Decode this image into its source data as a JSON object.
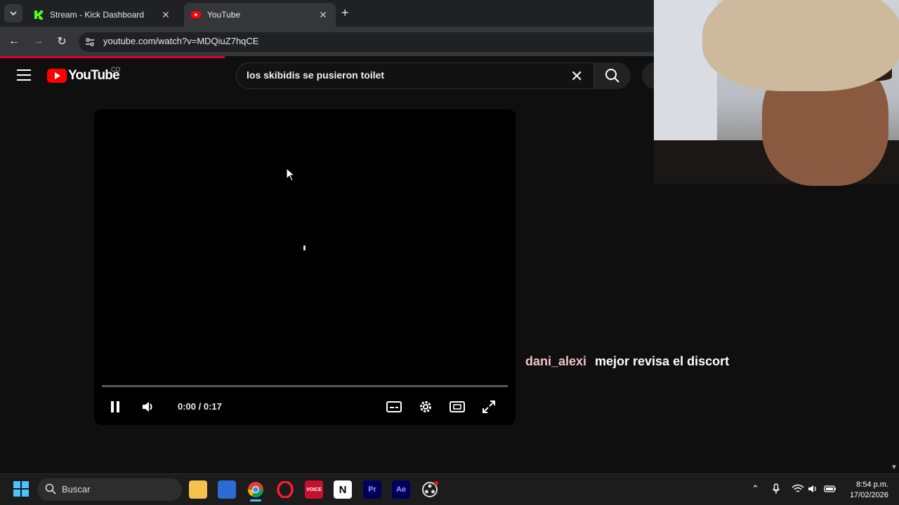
{
  "browser": {
    "tabs": [
      {
        "title": "Stream - Kick Dashboard",
        "favicon": "kick-icon",
        "active": false
      },
      {
        "title": "YouTube",
        "favicon": "youtube-icon",
        "active": true
      }
    ],
    "url": "youtube.com/watch?v=MDQiuZ7hqCE"
  },
  "youtube": {
    "logo_text": "YouTube",
    "country_code": "CO",
    "search_query": "los skibidis se pusieron toilet"
  },
  "player": {
    "time_display": "0:00 / 0:17",
    "state": "playing"
  },
  "chat": {
    "username": "dani_alexi",
    "message": "mejor revisa el discort"
  },
  "taskbar": {
    "search_placeholder": "Buscar",
    "time": "8:54 p.m.",
    "date": "17/02/2026",
    "apps": [
      "file-explorer",
      "microsoft-store",
      "chrome",
      "opera",
      "voicemeeter",
      "notion",
      "premiere-pro",
      "after-effects",
      "obs"
    ]
  },
  "colors": {
    "accent_red": "#ff0000",
    "chat_username": "#f4c2cf",
    "windows_blue": "#4cc2ff"
  }
}
